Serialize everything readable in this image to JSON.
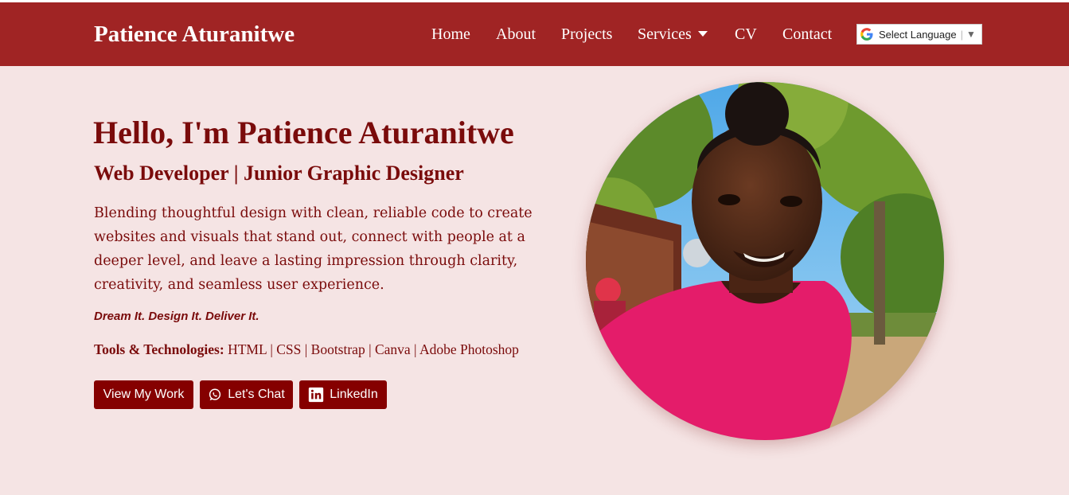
{
  "navbar": {
    "brand": "Patience Aturanitwe",
    "links": [
      "Home",
      "About",
      "Projects",
      "Services",
      "CV",
      "Contact"
    ],
    "language_select": {
      "label": "Select Language",
      "arrow": "▼"
    }
  },
  "hero": {
    "greeting": "Hello, I'm",
    "name": "Patience Aturanitwe",
    "role": "Web Developer | Junior Graphic Designer",
    "description": "Blending thoughtful design with clean, reliable code to create websites and visuals that stand out, connect with people at a deeper level, and leave a lasting impression through clarity, creativity, and seamless user experience.",
    "tagline": "Dream It. Design It. Deliver It.",
    "tools_label": "Tools & Technologies:",
    "tools": "HTML | CSS | Bootstrap | Canva | Adobe Photoshop",
    "buttons": {
      "work": "View My Work",
      "chat": "Let's Chat",
      "linkedin": "LinkedIn"
    }
  },
  "icons": {
    "google": "google-g-icon",
    "dropdown": "caret-down-icon",
    "whatsapp": "whatsapp-icon",
    "linkedin": "linkedin-icon"
  },
  "colors": {
    "navbar_bg": "#a02424",
    "page_bg": "#f5e4e4",
    "text": "#7a0b0b",
    "button_bg": "#850000"
  }
}
